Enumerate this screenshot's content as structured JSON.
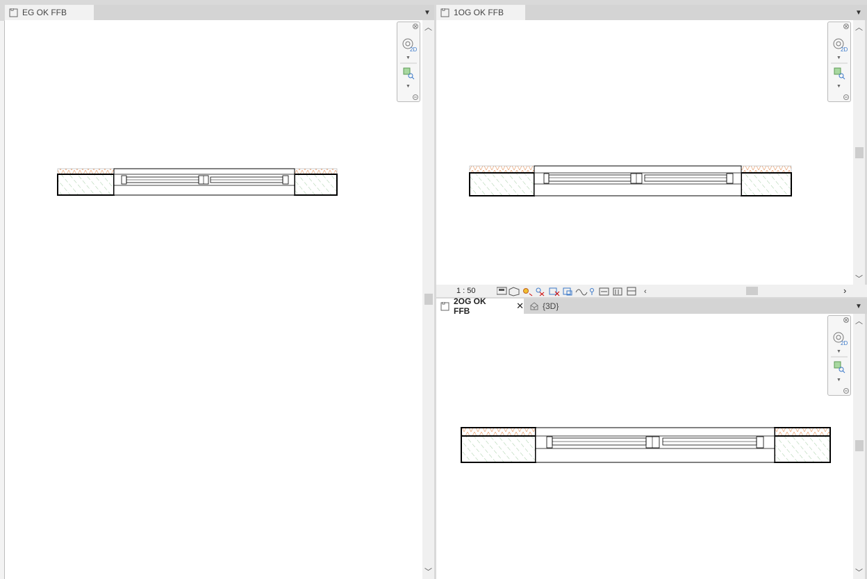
{
  "views": {
    "left": {
      "tab_label": "EG OK FFB"
    },
    "top_right": {
      "tab_label": "1OG OK FFB",
      "scale": "1 : 50"
    },
    "bottom_right": {
      "tabs": [
        {
          "label": "2OG OK FFB"
        },
        {
          "label": "{3D}"
        }
      ],
      "close_glyph": "✕"
    }
  },
  "icons": {
    "view_tab": "plan-view-icon",
    "three_d_tab": "3d-view-icon",
    "dropdown": "chevron-down-icon",
    "nav_close": "close-icon",
    "nav_wheel": "2d-steering-wheel-icon",
    "nav_zoom": "zoom-region-icon"
  },
  "colors": {
    "pane_bg": "#ffffff",
    "chrome": "#d4d4d4",
    "hatch_green": "#7fb27f",
    "hatch_orange": "#e8a070",
    "wall_line": "#000000"
  }
}
